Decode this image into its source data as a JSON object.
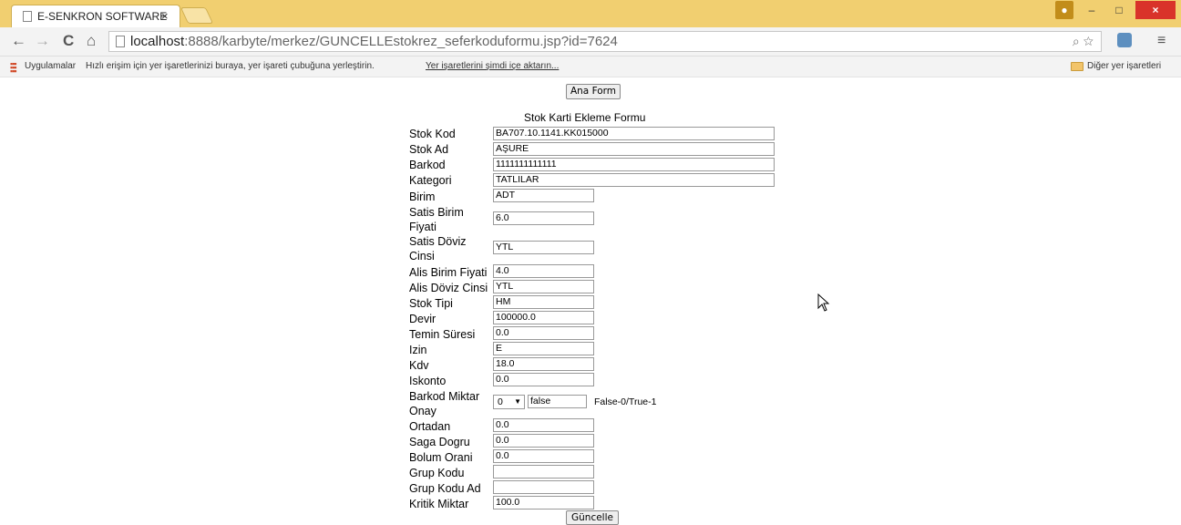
{
  "browser": {
    "tab_title": "E-SENKRON SOFTWARE",
    "tab_close": "×",
    "url_host": "localhost",
    "url_rest": ":8888/karbyte/merkez/GUNCELLEstokrez_seferkoduformu.jsp?id=7624",
    "back": "←",
    "forward": "→",
    "reload": "C",
    "home": "⌂",
    "zoom_star": "⌕ ☆",
    "menu": "≡",
    "win_min": "–",
    "win_max": "□",
    "win_close": "×"
  },
  "bookmarks": {
    "apps": "Uygulamalar",
    "hint": "Hızlı erişim için yer işaretlerinizi buraya, yer işareti çubuğuna yerleştirin.",
    "import": "Yer işaretlerini şimdi içe aktarın...",
    "other": "Diğer yer işaretleri"
  },
  "page": {
    "ana_form_button": "Ana Form",
    "form_title": "Stok Karti Ekleme Formu",
    "update_button": "Güncelle",
    "fields": {
      "stok_kod": {
        "label": "Stok Kod",
        "value": "BA707.10.1141.KK015000"
      },
      "stok_ad": {
        "label": "Stok Ad",
        "value": "AŞURE"
      },
      "barkod": {
        "label": "Barkod",
        "value": "1111111111111"
      },
      "kategori": {
        "label": "Kategori",
        "value": "TATLILAR"
      },
      "birim": {
        "label": "Birim",
        "value": "ADT"
      },
      "satis_birim_fiyati": {
        "label": "Satis Birim Fiyati",
        "value": "6.0"
      },
      "satis_doviz_cinsi": {
        "label": "Satis Döviz Cinsi",
        "value": "YTL"
      },
      "alis_birim_fiyati": {
        "label": "Alis Birim Fiyati",
        "value": "4.0"
      },
      "alis_doviz_cinsi": {
        "label": "Alis Döviz Cinsi",
        "value": "YTL"
      },
      "stok_tipi": {
        "label": "Stok Tipi",
        "value": "HM"
      },
      "devir": {
        "label": "Devir",
        "value": "100000.0"
      },
      "temin_suresi": {
        "label": "Temin Süresi",
        "value": "0.0"
      },
      "izin": {
        "label": "Izin",
        "value": "E"
      },
      "kdv": {
        "label": "Kdv",
        "value": "18.0"
      },
      "iskonto": {
        "label": "Iskonto",
        "value": "0.0"
      },
      "barkod_miktar_onay": {
        "label": "Barkod Miktar Onay",
        "select_value": "0",
        "value": "false",
        "hint": "False-0/True-1"
      },
      "ortadan": {
        "label": "Ortadan",
        "value": "0.0"
      },
      "saga_dogru": {
        "label": "Saga Dogru",
        "value": "0.0"
      },
      "bolum_orani": {
        "label": "Bolum Orani",
        "value": "0.0"
      },
      "grup_kodu": {
        "label": "Grup Kodu",
        "value": ""
      },
      "grup_kodu_ad": {
        "label": "Grup Kodu Ad",
        "value": ""
      },
      "kritik_miktar": {
        "label": "Kritik Miktar",
        "value": "100.0"
      }
    }
  }
}
